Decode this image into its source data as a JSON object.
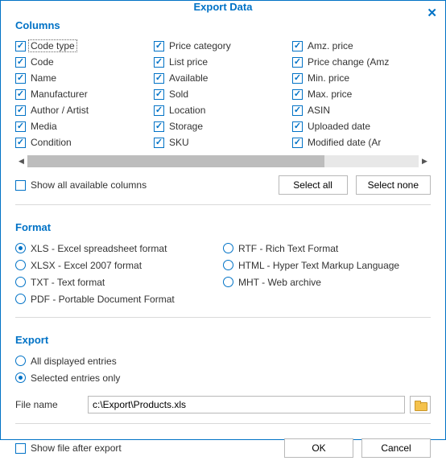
{
  "title": "Export Data",
  "sections": {
    "columns": "Columns",
    "format": "Format",
    "export": "Export"
  },
  "columns": {
    "col1": [
      {
        "label": "Code type",
        "checked": true,
        "focused": true
      },
      {
        "label": "Code",
        "checked": true
      },
      {
        "label": "Name",
        "checked": true
      },
      {
        "label": "Manufacturer",
        "checked": true
      },
      {
        "label": "Author / Artist",
        "checked": true
      },
      {
        "label": "Media",
        "checked": true
      },
      {
        "label": "Condition",
        "checked": true
      }
    ],
    "col2": [
      {
        "label": "Price category",
        "checked": true
      },
      {
        "label": "List price",
        "checked": true
      },
      {
        "label": "Available",
        "checked": true
      },
      {
        "label": "Sold",
        "checked": true
      },
      {
        "label": "Location",
        "checked": true
      },
      {
        "label": "Storage",
        "checked": true
      },
      {
        "label": "SKU",
        "checked": true
      }
    ],
    "col3": [
      {
        "label": "Amz. price",
        "checked": true
      },
      {
        "label": "Price change (Amz",
        "checked": true
      },
      {
        "label": "Min. price",
        "checked": true
      },
      {
        "label": "Max. price",
        "checked": true
      },
      {
        "label": "ASIN",
        "checked": true
      },
      {
        "label": "Uploaded date",
        "checked": true
      },
      {
        "label": "Modified date (Ar",
        "checked": true
      }
    ]
  },
  "show_all_columns": {
    "label": "Show all available columns",
    "checked": false
  },
  "buttons": {
    "select_all": "Select all",
    "select_none": "Select none",
    "ok": "OK",
    "cancel": "Cancel"
  },
  "formats": {
    "col1": [
      {
        "label": "XLS - Excel spreadsheet format",
        "checked": true
      },
      {
        "label": "XLSX - Excel 2007 format",
        "checked": false
      },
      {
        "label": "TXT - Text format",
        "checked": false
      },
      {
        "label": "PDF - Portable Document Format",
        "checked": false
      }
    ],
    "col2": [
      {
        "label": "RTF - Rich Text Format",
        "checked": false
      },
      {
        "label": "HTML - Hyper Text Markup Language",
        "checked": false
      },
      {
        "label": "MHT - Web archive",
        "checked": false
      }
    ]
  },
  "export_scope": [
    {
      "label": "All displayed entries",
      "checked": false
    },
    {
      "label": "Selected entries only",
      "checked": true
    }
  ],
  "filename": {
    "label": "File name",
    "value": "c:\\Export\\Products.xls"
  },
  "show_after": {
    "label": "Show file after export",
    "checked": false
  }
}
